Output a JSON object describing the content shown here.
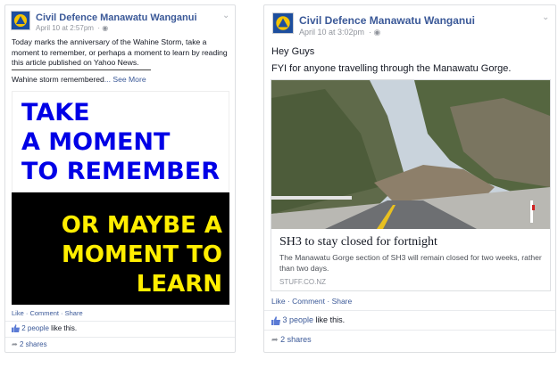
{
  "left_post": {
    "page_name": "Civil Defence Manawatu Wanganui",
    "timestamp": "April 10 at 2:57pm",
    "message": "Today marks the anniversary of the Wahine Storm, take a moment to remember, or perhaps a moment to learn by reading this article published on Yahoo News.",
    "link_preview_text": "Wahine storm remembered",
    "see_more": "... See More",
    "image_lines_top": [
      "TAKE",
      "A MOMENT",
      "TO REMEMBER"
    ],
    "image_lines_bottom": [
      "OR MAYBE A",
      "MOMENT TO",
      "LEARN"
    ],
    "actions": {
      "like": "Like",
      "comment": "Comment",
      "share": "Share",
      "dot": " · "
    },
    "likes_text": "2 people",
    "likes_suffix": " like this.",
    "shares_text": "2 shares"
  },
  "right_post": {
    "page_name": "Civil Defence Manawatu Wanganui",
    "timestamp": "April 10 at 3:02pm",
    "greeting": "Hey Guys",
    "message": "FYI for anyone travelling through the Manawatu Gorge.",
    "link_title": "SH3 to stay closed for fortnight",
    "link_description": "The Manawatu Gorge section of SH3 will remain closed for two weeks, rather than two days.",
    "link_source": "STUFF.CO.NZ",
    "actions": {
      "like": "Like",
      "comment": "Comment",
      "share": "Share",
      "dot": " · "
    },
    "likes_text": "3 people",
    "likes_suffix": " like this.",
    "shares_text": "2 shares"
  },
  "colors": {
    "link_blue": "#3b5998",
    "ad_blue": "#0000e6",
    "ad_yellow": "#ffee00"
  },
  "icons": [
    "civil-defence-logo-icon",
    "globe-icon",
    "chevron-down-icon",
    "thumbs-up-icon",
    "share-arrow-icon"
  ]
}
